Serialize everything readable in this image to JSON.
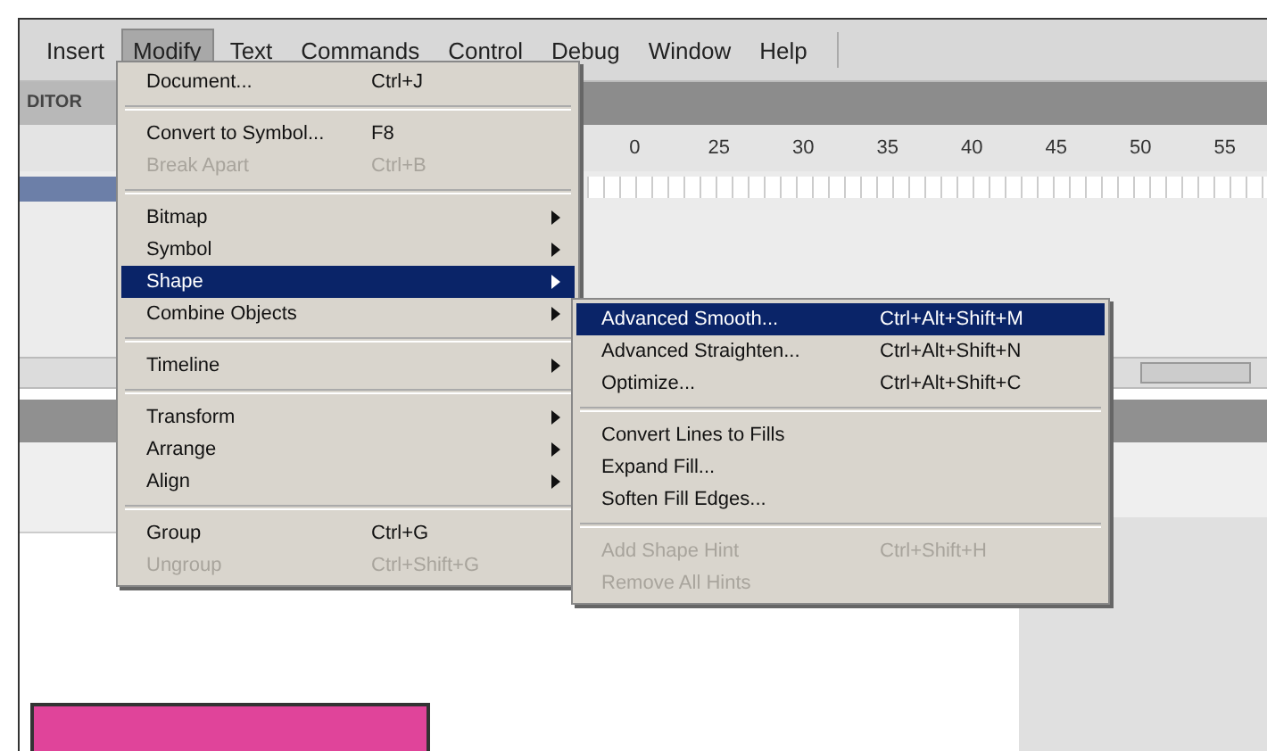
{
  "menubar": [
    {
      "label": "Insert",
      "selected": false
    },
    {
      "label": "Modify",
      "selected": true
    },
    {
      "label": "Text",
      "selected": false
    },
    {
      "label": "Commands",
      "selected": false
    },
    {
      "label": "Control",
      "selected": false
    },
    {
      "label": "Debug",
      "selected": false
    },
    {
      "label": "Window",
      "selected": false
    },
    {
      "label": "Help",
      "selected": false
    }
  ],
  "editor_tab": "DITOR",
  "ruler": [
    "0",
    "25",
    "30",
    "35",
    "40",
    "45",
    "50",
    "55"
  ],
  "menu": [
    {
      "kind": "item",
      "label": "Document...",
      "shortcut": "Ctrl+J",
      "disabled": false,
      "submenu": false,
      "selected": false
    },
    {
      "kind": "separator"
    },
    {
      "kind": "item",
      "label": "Convert to Symbol...",
      "shortcut": "F8",
      "disabled": false,
      "submenu": false,
      "selected": false
    },
    {
      "kind": "item",
      "label": "Break Apart",
      "shortcut": "Ctrl+B",
      "disabled": true,
      "submenu": false,
      "selected": false
    },
    {
      "kind": "separator"
    },
    {
      "kind": "item",
      "label": "Bitmap",
      "disabled": false,
      "submenu": true,
      "selected": false
    },
    {
      "kind": "item",
      "label": "Symbol",
      "disabled": false,
      "submenu": true,
      "selected": false
    },
    {
      "kind": "item",
      "label": "Shape",
      "disabled": false,
      "submenu": true,
      "selected": true
    },
    {
      "kind": "item",
      "label": "Combine Objects",
      "disabled": false,
      "submenu": true,
      "selected": false
    },
    {
      "kind": "separator"
    },
    {
      "kind": "item",
      "label": "Timeline",
      "disabled": false,
      "submenu": true,
      "selected": false
    },
    {
      "kind": "separator"
    },
    {
      "kind": "item",
      "label": "Transform",
      "disabled": false,
      "submenu": true,
      "selected": false
    },
    {
      "kind": "item",
      "label": "Arrange",
      "disabled": false,
      "submenu": true,
      "selected": false
    },
    {
      "kind": "item",
      "label": "Align",
      "disabled": false,
      "submenu": true,
      "selected": false
    },
    {
      "kind": "separator"
    },
    {
      "kind": "item",
      "label": "Group",
      "shortcut": "Ctrl+G",
      "disabled": false,
      "submenu": false,
      "selected": false
    },
    {
      "kind": "item",
      "label": "Ungroup",
      "shortcut": "Ctrl+Shift+G",
      "disabled": true,
      "submenu": false,
      "selected": false
    }
  ],
  "submenu": [
    {
      "kind": "item",
      "label": "Advanced Smooth...",
      "shortcut": "Ctrl+Alt+Shift+M",
      "disabled": false,
      "submenu": false,
      "selected": true
    },
    {
      "kind": "item",
      "label": "Advanced Straighten...",
      "shortcut": "Ctrl+Alt+Shift+N",
      "disabled": false,
      "submenu": false,
      "selected": false
    },
    {
      "kind": "item",
      "label": "Optimize...",
      "shortcut": "Ctrl+Alt+Shift+C",
      "disabled": false,
      "submenu": false,
      "selected": false
    },
    {
      "kind": "separator"
    },
    {
      "kind": "item",
      "label": "Convert Lines to Fills",
      "disabled": false,
      "submenu": false,
      "selected": false
    },
    {
      "kind": "item",
      "label": "Expand Fill...",
      "disabled": false,
      "submenu": false,
      "selected": false
    },
    {
      "kind": "item",
      "label": "Soften Fill Edges...",
      "disabled": false,
      "submenu": false,
      "selected": false
    },
    {
      "kind": "separator"
    },
    {
      "kind": "item",
      "label": "Add Shape Hint",
      "shortcut": "Ctrl+Shift+H",
      "disabled": true,
      "submenu": false,
      "selected": false
    },
    {
      "kind": "item",
      "label": "Remove All Hints",
      "disabled": true,
      "submenu": false,
      "selected": false
    }
  ]
}
